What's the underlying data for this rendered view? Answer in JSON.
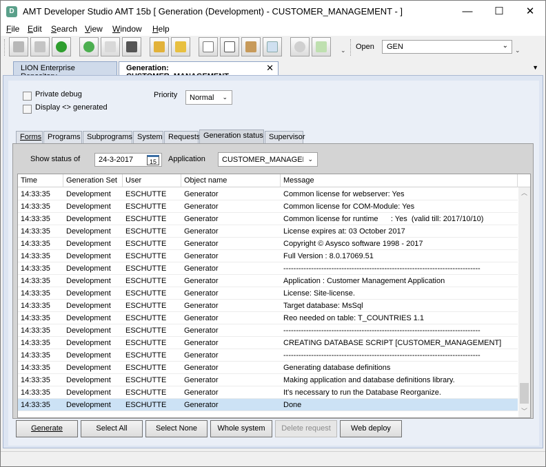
{
  "window": {
    "title": "AMT Developer Studio AMT 15b  [ Generation (Development) - CUSTOMER_MANAGEMENT - ]",
    "app_icon_letter": "D",
    "minimize_glyph": "—",
    "maximize_glyph": "☐",
    "close_glyph": "✕"
  },
  "menu": [
    {
      "mnemonic": "F",
      "rest": "ile"
    },
    {
      "mnemonic": "E",
      "rest": "dit"
    },
    {
      "mnemonic": "S",
      "rest": "earch"
    },
    {
      "mnemonic": "V",
      "rest": "iew"
    },
    {
      "mnemonic": "W",
      "rest": "indow"
    },
    {
      "mnemonic": "H",
      "rest": "elp"
    }
  ],
  "toolbar": {
    "icons": [
      "save-icon",
      "save-all-icon",
      "refresh-icon",
      "help-icon",
      "search-icon",
      "print-icon",
      "lock-icon",
      "settings-icon",
      "copy-icon",
      "cut-icon",
      "paste-icon",
      "select-icon",
      "gear-icon",
      "export-icon"
    ],
    "open_label": "Open",
    "open_value": "GEN",
    "dropdown_glyph": "⌄"
  },
  "doc_tabs": {
    "inactive": "LION Enterprise Repository",
    "active": "Generation: CUSTOMER_MANAGEMENT",
    "close_glyph": "✕",
    "menu_glyph": "▼"
  },
  "options": {
    "private_debug": "Private debug",
    "display_generated": "Display <> generated",
    "priority_label": "Priority",
    "priority_value": "Normal"
  },
  "tabs": [
    "Forms",
    "Programs",
    "Subprograms",
    "System",
    "Requests",
    "Generation status",
    "Supervisor"
  ],
  "active_tab": "Generation status",
  "status_panel": {
    "show_status_label": "Show status of",
    "date_value": "24-3-2017",
    "calendar_day": "15",
    "application_label": "Application",
    "application_value": "CUSTOMER_MANAGEMENT"
  },
  "grid": {
    "columns": [
      "Time",
      "Generation Set",
      "User",
      "Object name",
      "Message"
    ],
    "rows": [
      [
        "14:33:35",
        "Development",
        "ESCHUTTE",
        "Generator",
        "Common license for webserver: Yes"
      ],
      [
        "14:33:35",
        "Development",
        "ESCHUTTE",
        "Generator",
        "Common license for COM-Module: Yes"
      ],
      [
        "14:33:35",
        "Development",
        "ESCHUTTE",
        "Generator",
        "Common license for runtime      : Yes  (valid till: 2017/10/10)"
      ],
      [
        "14:33:35",
        "Development",
        "ESCHUTTE",
        "Generator",
        "License expires at: 03 October 2017"
      ],
      [
        "14:33:35",
        "Development",
        "ESCHUTTE",
        "Generator",
        "Copyright © Asysco software 1998 - 2017"
      ],
      [
        "14:33:35",
        "Development",
        "ESCHUTTE",
        "Generator",
        "Full Version : 8.0.17069.51"
      ],
      [
        "14:33:35",
        "Development",
        "ESCHUTTE",
        "Generator",
        "------------------------------------------------------------------------------"
      ],
      [
        "14:33:35",
        "Development",
        "ESCHUTTE",
        "Generator",
        "Application : Customer Management Application"
      ],
      [
        "14:33:35",
        "Development",
        "ESCHUTTE",
        "Generator",
        "License: Site-license."
      ],
      [
        "14:33:35",
        "Development",
        "ESCHUTTE",
        "Generator",
        "Target database: MsSql"
      ],
      [
        "14:33:35",
        "Development",
        "ESCHUTTE",
        "Generator",
        "Reo needed on table: T_COUNTRIES 1.1"
      ],
      [
        "14:33:35",
        "Development",
        "ESCHUTTE",
        "Generator",
        "------------------------------------------------------------------------------"
      ],
      [
        "14:33:35",
        "Development",
        "ESCHUTTE",
        "Generator",
        "CREATING DATABASE SCRIPT [CUSTOMER_MANAGEMENT]"
      ],
      [
        "14:33:35",
        "Development",
        "ESCHUTTE",
        "Generator",
        "------------------------------------------------------------------------------"
      ],
      [
        "14:33:35",
        "Development",
        "ESCHUTTE",
        "Generator",
        "Generating database definitions"
      ],
      [
        "14:33:35",
        "Development",
        "ESCHUTTE",
        "Generator",
        "Making application and database definitions library."
      ],
      [
        "14:33:35",
        "Development",
        "ESCHUTTE",
        "Generator",
        "It's necessary to run the Database Reorganize."
      ],
      [
        "14:33:35",
        "Development",
        "ESCHUTTE",
        "Generator",
        "Done"
      ]
    ],
    "selected_row": 17
  },
  "buttons": {
    "generate": "Generate",
    "select_all": "Select All",
    "select_none": "Select None",
    "whole_system": "Whole system",
    "delete_request": "Delete request",
    "web_deploy": "Web deploy"
  },
  "colors": {
    "selection": "#cce2f5",
    "accent_tab": "#3a6ea5",
    "refresh_green": "#2e9e2e",
    "help_green": "#4caf50"
  }
}
